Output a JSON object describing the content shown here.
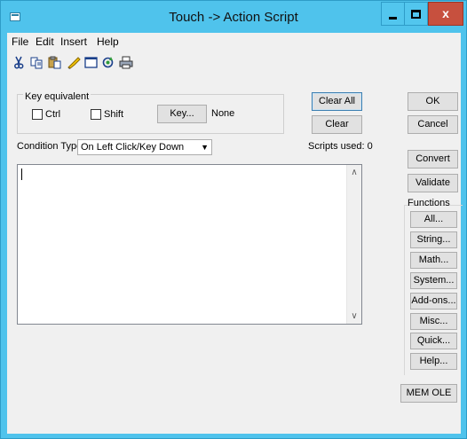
{
  "window": {
    "title": "Touch -> Action Script",
    "close_glyph": "x"
  },
  "menu": {
    "items": [
      "File",
      "Edit",
      "Insert",
      "Help"
    ]
  },
  "toolbar": {
    "icons": [
      "cut-icon",
      "copy-icon",
      "paste-icon",
      "highlight-icon",
      "window-icon",
      "refresh-icon",
      "print-icon"
    ]
  },
  "key_equivalent": {
    "group_label": "Key equivalent",
    "ctrl_label": "Ctrl",
    "ctrl_checked": false,
    "shift_label": "Shift",
    "shift_checked": false,
    "key_button": "Key...",
    "key_value": "None"
  },
  "buttons": {
    "clear_all": "Clear All",
    "clear": "Clear",
    "ok": "OK",
    "cancel": "Cancel",
    "convert": "Convert",
    "validate": "Validate",
    "mem_ole": "MEM OLE"
  },
  "condition": {
    "label": "Condition Type:",
    "value": "On Left Click/Key Down"
  },
  "scripts_used": "Scripts used: 0",
  "script_text": "",
  "functions": {
    "label": "Functions",
    "buttons": [
      "All...",
      "String...",
      "Math...",
      "System...",
      "Add-ons...",
      "Misc...",
      "Quick...",
      "Help..."
    ]
  }
}
